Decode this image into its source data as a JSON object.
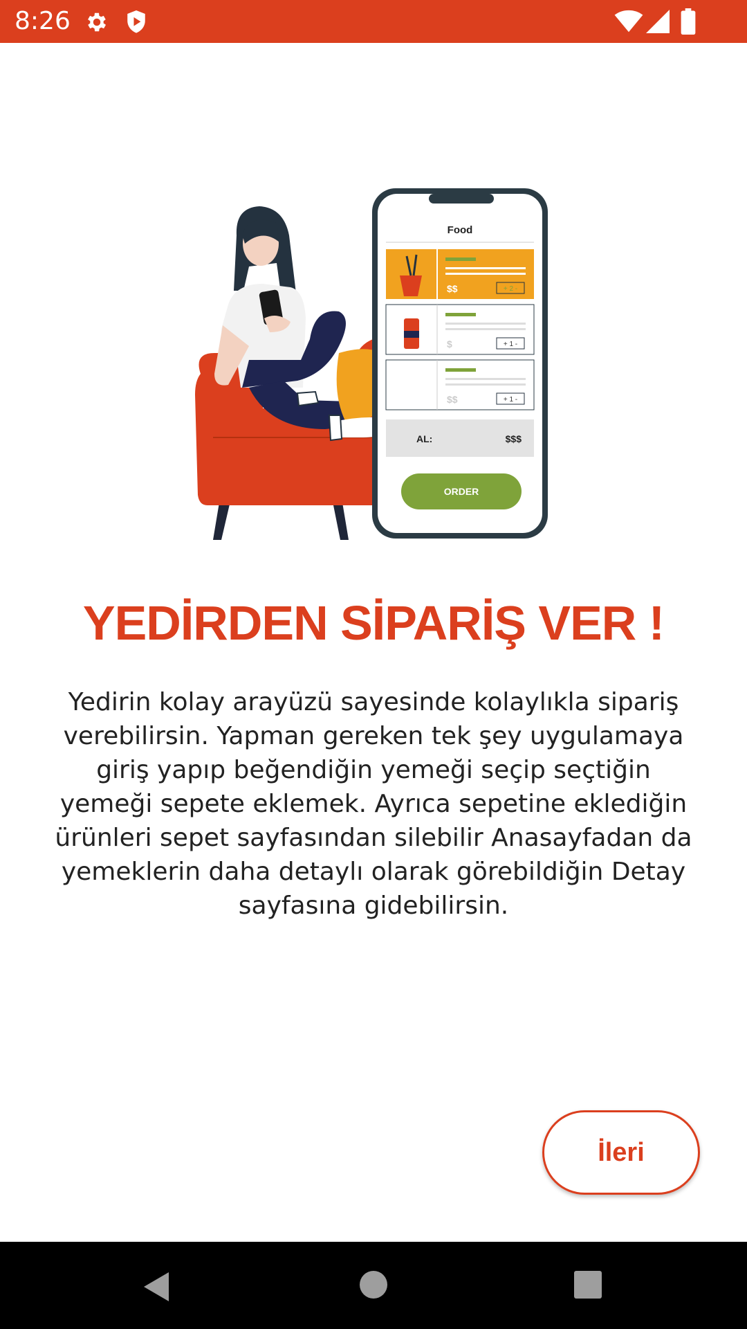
{
  "status_bar": {
    "time": "8:26",
    "background_color": "#db3f1e",
    "left_icons": [
      "settings-gear-icon",
      "shield-play-icon"
    ],
    "right_icons": [
      "wifi-icon",
      "cell-signal-icon",
      "battery-icon"
    ]
  },
  "illustration": {
    "phone_title": "Food",
    "items": [
      {
        "price": "$$",
        "qty": "+ 2 -"
      },
      {
        "price": "$",
        "qty": "+ 1 -"
      },
      {
        "price": "$$",
        "qty": "+ 1 -"
      }
    ],
    "total_label": "AL:",
    "total_value": "$$$",
    "order_button": "ORDER"
  },
  "content": {
    "headline": "YEDİRDEN SİPARİŞ VER !",
    "description": "Yedirin kolay arayüzü sayesinde kolaylıkla sipariş verebilirsin. Yapman gereken tek şey uygulamaya giriş yapıp beğendiğin yemeği seçip seçtiğin yemeği sepete eklemek. Ayrıca sepetine eklediğin ürünleri sepet sayfasından silebilir Anasayfadan da yemeklerin daha detaylı olarak görebildiğin Detay sayfasına gidebilirsin.",
    "accent_color": "#db3f1e"
  },
  "actions": {
    "next_label": "İleri"
  },
  "nav_bar": {
    "buttons": [
      "back-icon",
      "home-icon",
      "recents-icon"
    ]
  }
}
